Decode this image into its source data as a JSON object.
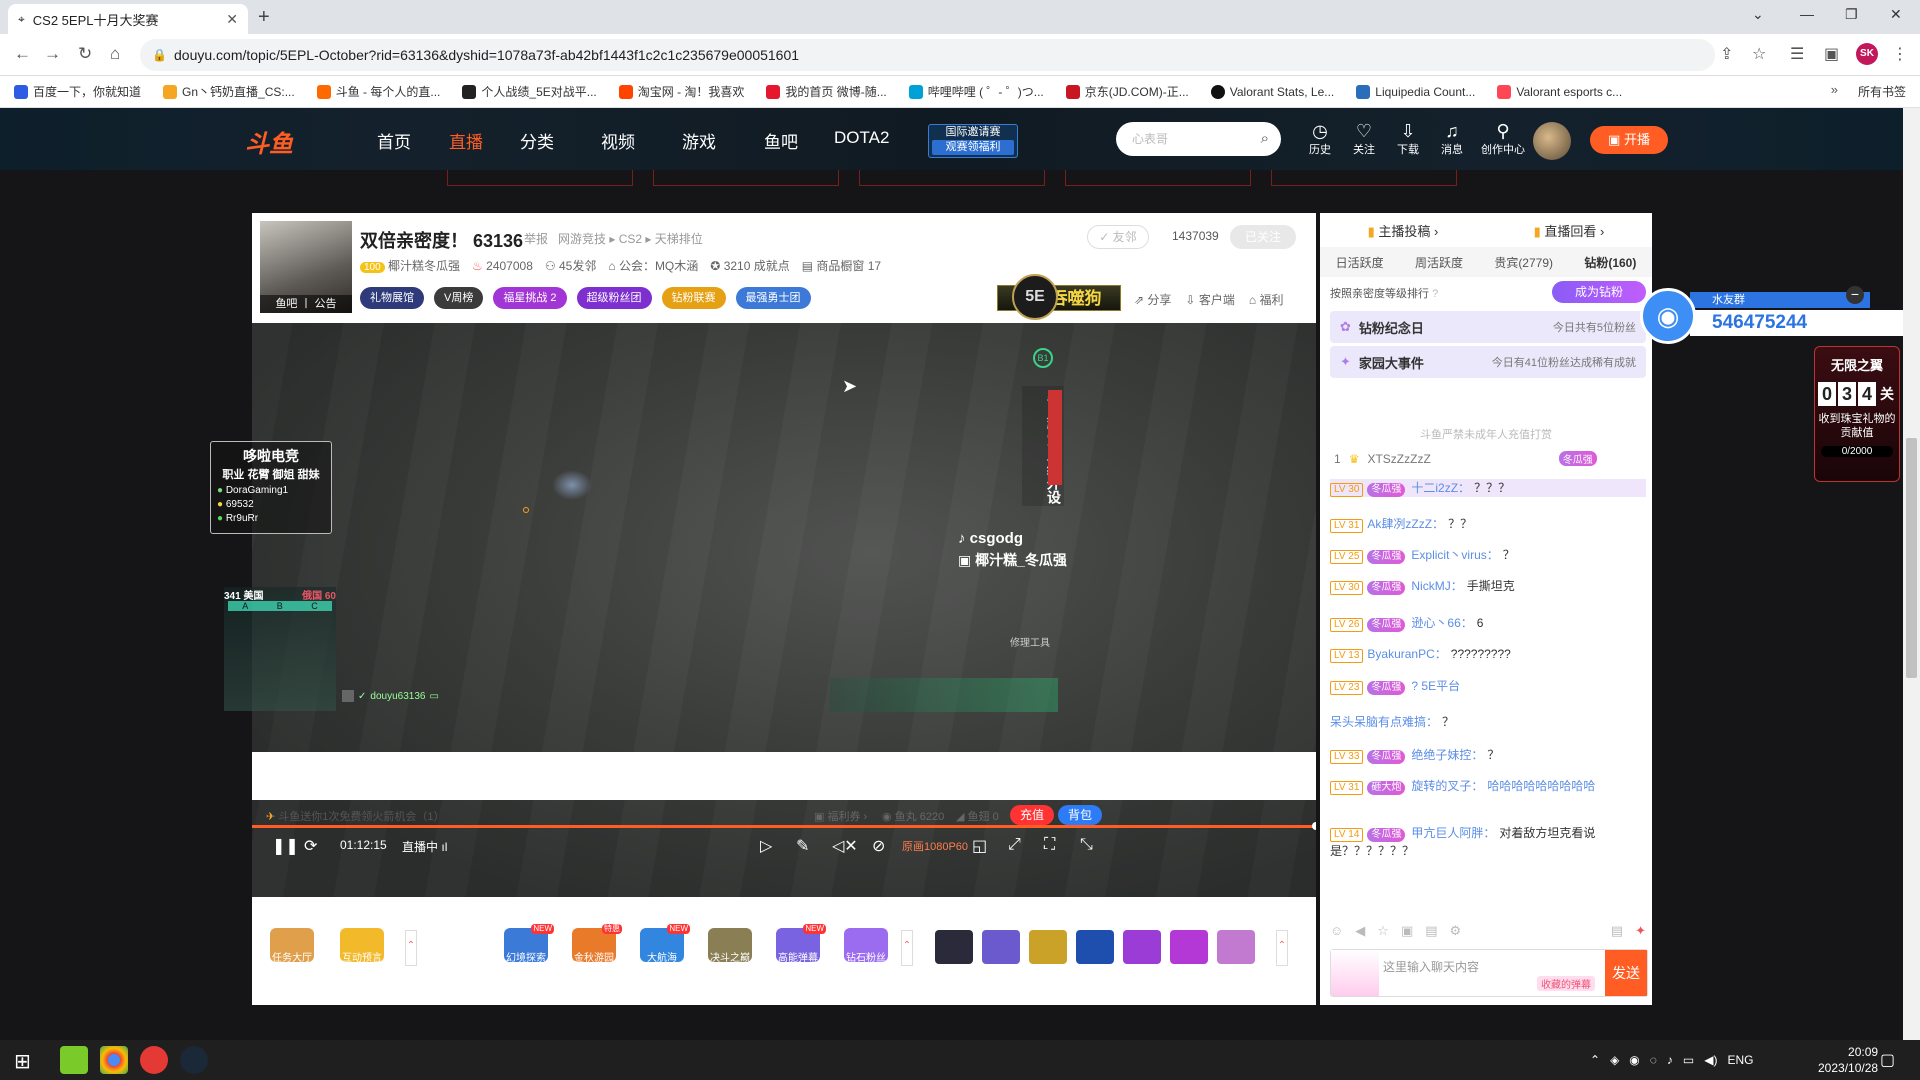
{
  "browser": {
    "tab_title": "CS2 5EPL十月大奖赛",
    "url": "douyu.com/topic/5EPL-October?rid=63136&dyshid=1078a73f-ab42bf1443f1c2c1c235679e00051601",
    "profile_initials": "SK",
    "bookmarks": [
      "百度一下，你就知道",
      "Gn丶钙奶直播_CS:...",
      "斗鱼 - 每个人的直...",
      "个人战绩_5E对战平...",
      "淘宝网 - 淘！我喜欢",
      "我的首页 微博-随...",
      "哔哩哔哩 ( ゜- ゜)つ...",
      "京东(JD.COM)-正...",
      "Valorant Stats, Le...",
      "Liquipedia Count...",
      "Valorant esports c..."
    ],
    "bookmarks_folder": "所有书签"
  },
  "site": {
    "logo": "斗鱼",
    "nav": [
      "首页",
      "直播",
      "分类",
      "视频",
      "游戏",
      "鱼吧",
      "DOTA2"
    ],
    "invite_line1": "国际邀请赛",
    "invite_line2": "观赛领福利",
    "search_placeholder": "心表哥",
    "icons": [
      "历史",
      "关注",
      "下载",
      "消息",
      "创作中心"
    ],
    "go_live": "开播"
  },
  "room": {
    "poster_tag": "鱼吧 丨 公告",
    "title": "双倍亲密度！ 63136",
    "report": "举报",
    "category": "网游竞技 ▸ CS2 ▸ 天梯排位",
    "friend_btn": "✓ 友邻",
    "fans_count": "1437039",
    "follow_btn": "已关注",
    "level_badge": "100",
    "anchor_name": "椰汁糕冬瓜强",
    "hot": "2407008",
    "members": "45发邻",
    "guild": "公会：MQ木涵",
    "achievements": "3210 成就点",
    "shop": "商品橱窗 17",
    "pills": [
      "礼物展馆",
      "V周榜",
      "福星挑战 2",
      "超级粉丝团",
      "钻粉联赛",
      "最强勇士团"
    ],
    "banner": "无限吞噬狗",
    "actions": [
      "分享",
      "客户端",
      "福利"
    ]
  },
  "video": {
    "logo_5e": "5E",
    "badge_b1": "B1",
    "side_ad": "冬瓜强军工级外设",
    "card": {
      "title": "哆啦电竞",
      "tags": "职业 花臂 御姐 甜妹",
      "rows": [
        "DoraGaming1",
        "69532",
        "Rr9uRr"
      ]
    },
    "tiktok": "csgodg",
    "weibo": "椰汁糕_冬瓜强",
    "score_left": "341 美国",
    "score_right": "俄国 60",
    "map_letters": [
      "A",
      "B",
      "C"
    ],
    "viewer_name": "douyu63136",
    "hud_tag": "修理工具",
    "time": "01:12:15",
    "status": "直播中",
    "quality": "原画1080P60"
  },
  "gifts": {
    "left": [
      "任务大厅",
      "互动预言"
    ],
    "items": [
      {
        "label": "幻境探索",
        "new": "NEW"
      },
      {
        "label": "金秋游园",
        "new": "特惠"
      },
      {
        "label": "大航海",
        "new": "NEW"
      },
      {
        "label": "决斗之巅",
        "new": ""
      },
      {
        "label": "高能弹幕",
        "new": "NEW"
      },
      {
        "label": "钻石粉丝",
        "new": ""
      }
    ],
    "box_colors": [
      "#2a2a3a",
      "#6a5acd",
      "#c9a227",
      "#1e4fae",
      "#9b3cd6",
      "#b438d6",
      "#c27ad0"
    ]
  },
  "bottom": {
    "free_hint": "斗鱼送你1次免费领火箭机会（1）",
    "welfare": "福利券",
    "fish_balls": "鱼丸 6220",
    "fish_fins": "鱼翅 0",
    "charge": "充值",
    "bag": "背包"
  },
  "chat": {
    "top_tabs": [
      "主播投稿 ›",
      "直播回看 ›"
    ],
    "tabs": [
      "日活跃度",
      "周活跃度",
      "贵宾(2779)",
      "钻粉(160)"
    ],
    "rank_hint": "按照亲密度等级排行",
    "become_fan": "成为钻粉",
    "card1_title": "钻粉纪念日",
    "card1_sub": "今日共有5位粉丝",
    "card2_title": "家园大事件",
    "card2_sub": "今日有41位粉丝达成稀有成就",
    "warn": "斗鱼严禁未成年人充值打赏",
    "rank1": "XTSzZzZzZ",
    "rank1_badge": "冬瓜强",
    "messages": [
      {
        "lv": "LV 30",
        "badge": "冬瓜强",
        "user": "十二i2zZ：",
        "text": "？？？"
      },
      {
        "lv": "LV 31",
        "badge": "",
        "user": "Ak肆冽zZzZ：",
        "text": "？？"
      },
      {
        "lv": "LV 25",
        "badge": "冬瓜强",
        "user": "Explicit丶virus：",
        "text": "？"
      },
      {
        "lv": "LV 30",
        "badge": "冬瓜强",
        "user": "NickMJ：",
        "text": "手撕坦克"
      },
      {
        "lv": "LV 26",
        "badge": "冬瓜强",
        "user": "逊心丶66：",
        "text": "6"
      },
      {
        "lv": "LV 13",
        "badge": "",
        "user": "ByakuranPC：",
        "text": "?????????"
      },
      {
        "lv": "LV 23",
        "badge": "冬瓜强",
        "user": "?  5E平台",
        "text": ""
      },
      {
        "lv": "",
        "badge": "",
        "user": "呆头呆脑有点难搞：",
        "text": "？"
      },
      {
        "lv": "LV 33",
        "badge": "冬瓜强",
        "user": "绝绝子妹控：",
        "text": "？"
      },
      {
        "lv": "LV 31",
        "badge": "砸大炮",
        "user": "旋转的叉子：",
        "text": "哈哈哈哈哈哈哈哈哈"
      },
      {
        "lv": "LV 14",
        "badge": "冬瓜强",
        "user": "甲亢巨人阿胖：",
        "text": "对着敌方坦克看说是？？？？？？"
      }
    ],
    "input_placeholder": "这里输入聊天内容",
    "collect": "收藏的弹幕",
    "send": "发送"
  },
  "float": {
    "name": "水友群",
    "number": "546475244",
    "level_title": "无限之翼",
    "digits": [
      "0",
      "3",
      "4"
    ],
    "digit_unit": "关",
    "desc": "收到珠宝礼物的贡献值",
    "progress": "0/2000"
  },
  "taskbar": {
    "time": "20:09",
    "date": "2023/10/28",
    "lang": "ENG"
  }
}
